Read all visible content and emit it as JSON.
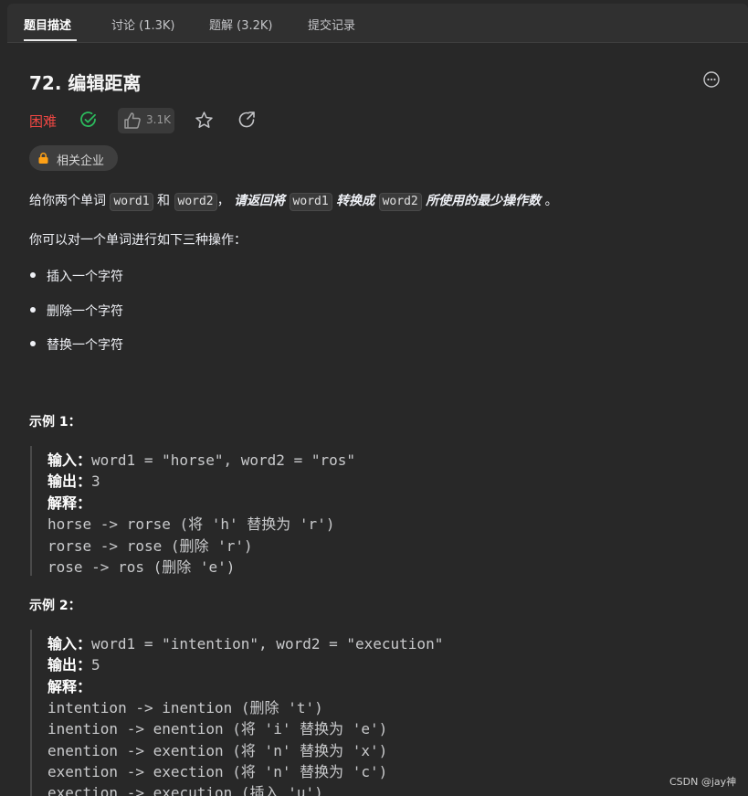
{
  "tabs": [
    {
      "label": "题目描述"
    },
    {
      "label": "讨论 (1.3K)"
    },
    {
      "label": "题解 (3.2K)"
    },
    {
      "label": "提交记录"
    }
  ],
  "problem": {
    "title": "72. 编辑距离",
    "difficulty": "困难",
    "likes": "3.1K",
    "company_tag": "相关企业",
    "colors": {
      "difficulty": "#ef4743",
      "solved": "#2cbb5d"
    }
  },
  "description": {
    "p1_prefix": "给你两个单词",
    "p1_code1": "word1",
    "p1_and": "和",
    "p1_code2": "word2",
    "p1_comma": "，",
    "p1_mid": "请返回将",
    "p1_code3": "word1",
    "p1_mid2": "转换成",
    "p1_code4": "word2",
    "p1_tail": "所使用的最少操作数",
    "p1_end": "。",
    "p2": "你可以对一个单词进行如下三种操作：",
    "ops": [
      "插入一个字符",
      "删除一个字符",
      "替换一个字符"
    ]
  },
  "examples": [
    {
      "title": "示例 1：",
      "input_label": "输入：",
      "input": "word1 = \"horse\", word2 = \"ros\"",
      "output_label": "输出：",
      "output": "3",
      "explain_label": "解释：",
      "lines": [
        "horse -> rorse (将 'h' 替换为 'r')",
        "rorse -> rose (删除 'r')",
        "rose -> ros (删除 'e')"
      ]
    },
    {
      "title": "示例 2：",
      "input_label": "输入：",
      "input": "word1 = \"intention\", word2 = \"execution\"",
      "output_label": "输出：",
      "output": "5",
      "explain_label": "解释：",
      "lines": [
        "intention -> inention (删除 't')",
        "inention -> enention (将 'i' 替换为 'e')",
        "enention -> exention (将 'n' 替换为 'x')",
        "exention -> exection (将 'n' 替换为 'c')",
        "exection -> execution (插入 'u')"
      ]
    }
  ],
  "watermark": "CSDN @jay神"
}
